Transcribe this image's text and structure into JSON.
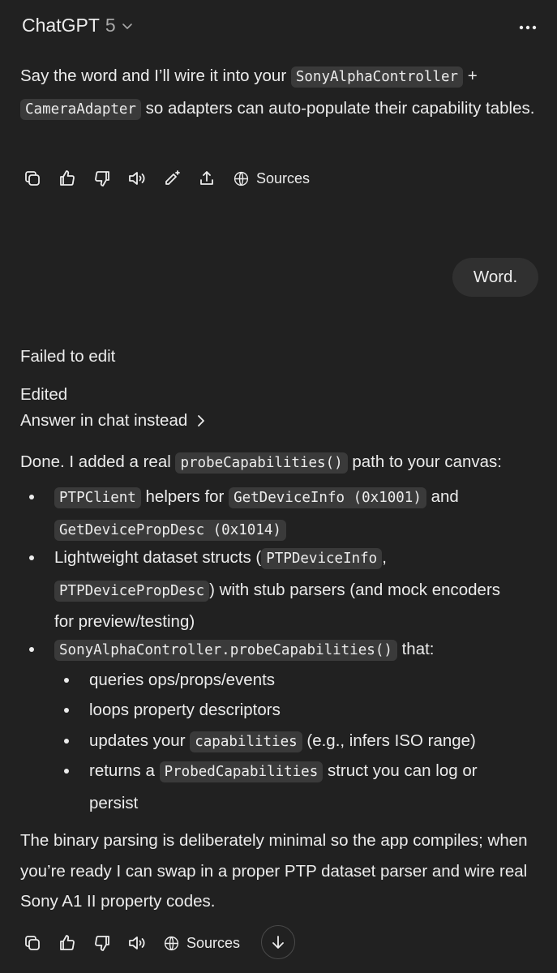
{
  "header": {
    "model_name": "ChatGPT",
    "model_version": "5"
  },
  "msg1": {
    "t1": "Say the word and I’ll wire it into your ",
    "c1": "SonyAlphaController",
    "t2": " + ",
    "c2": "CameraAdapter",
    "t3": " so adapters can auto-populate their capability tables."
  },
  "actions": {
    "sources_label": "Sources"
  },
  "user_message": "Word.",
  "status": {
    "failed": "Failed to edit",
    "edited": "Edited",
    "answer_in_chat": "Answer in chat instead"
  },
  "msg2": {
    "intro_t1": "Done. I added a real ",
    "intro_c1": "probeCapabilities()",
    "intro_t2": " path to your canvas:",
    "b1_c1": "PTPClient",
    "b1_t1": " helpers for ",
    "b1_c2": "GetDeviceInfo (0x1001)",
    "b1_t2": " and",
    "b1_c3": "GetDevicePropDesc (0x1014)",
    "b2_t1": "Lightweight dataset structs (",
    "b2_c1": "PTPDeviceInfo",
    "b2_t2": ",",
    "b2_c2": "PTPDevicePropDesc",
    "b2_t3": ") with stub parsers (and mock encoders",
    "b2_t4": "for preview/testing)",
    "b3_c1": "SonyAlphaController.probeCapabilities()",
    "b3_t1": " that:",
    "s1": "queries ops/props/events",
    "s2": "loops property descriptors",
    "s3_t1": "updates your ",
    "s3_c1": "capabilities",
    "s3_t2": " (e.g., infers ISO range)",
    "s4_t1": "returns a ",
    "s4_c1": "ProbedCapabilities",
    "s4_t2": " struct you can log or",
    "s4_t3": "persist",
    "outro": "The binary parsing is deliberately minimal so the app compiles; when you’re ready I can swap in a proper PTP dataset parser and wire real Sony A1 II property codes."
  }
}
